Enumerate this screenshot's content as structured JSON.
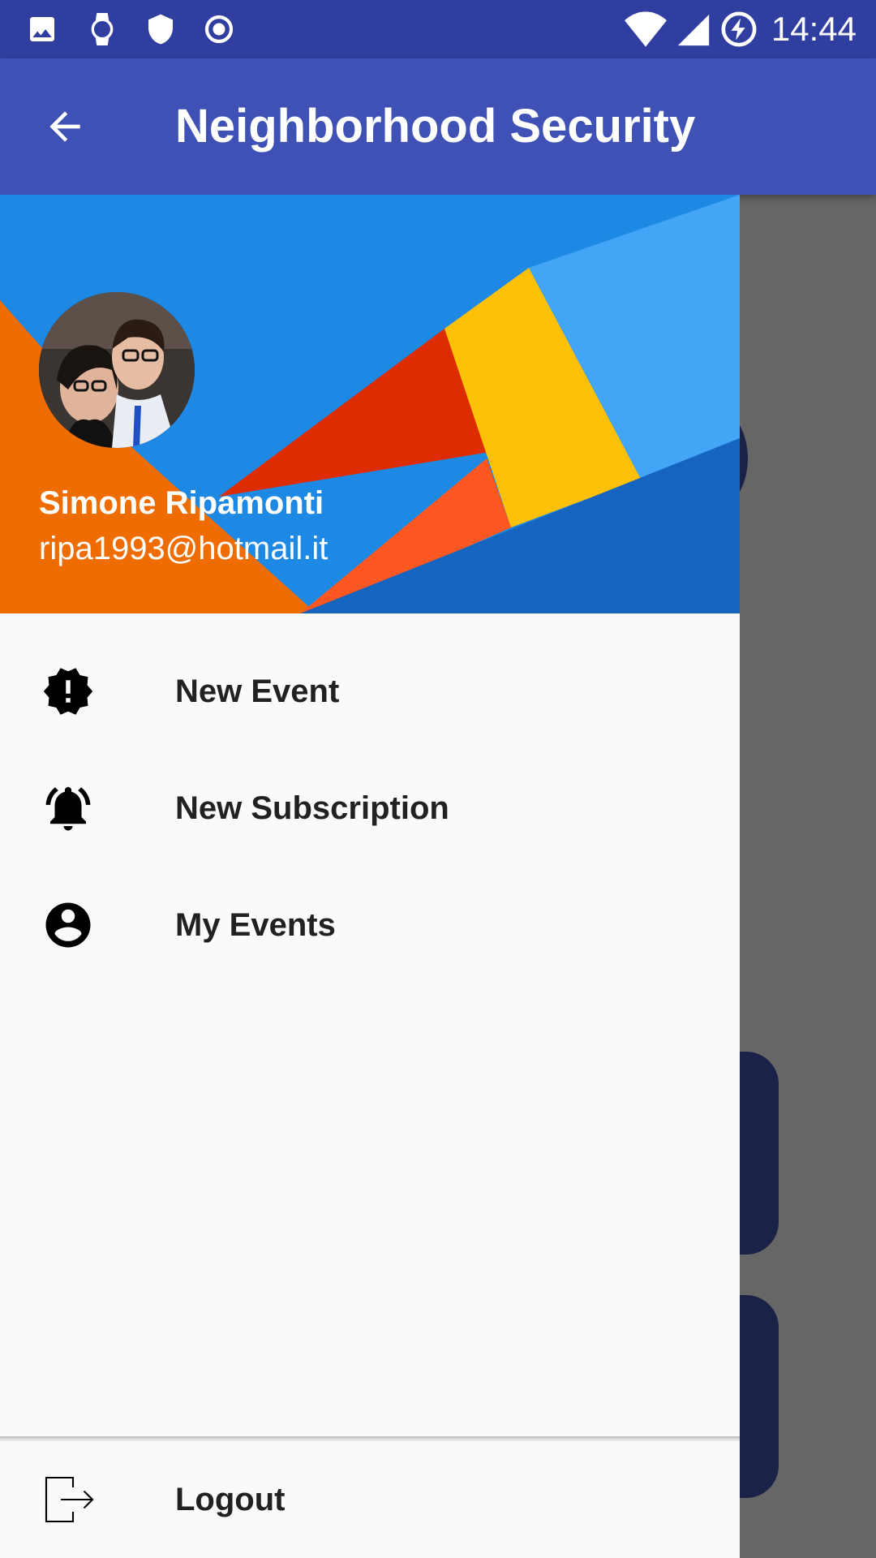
{
  "status_bar": {
    "time": "14:44",
    "icons": [
      "image-icon",
      "watch-icon",
      "shield-icon",
      "record-icon",
      "wifi-icon",
      "signal-icon",
      "battery-charging-icon"
    ]
  },
  "app_bar": {
    "title": "Neighborhood Security",
    "back_icon": "arrow-back-icon"
  },
  "drawer": {
    "header": {
      "name": "Simone Ripamonti",
      "email": "ripa1993@hotmail.it"
    },
    "items": [
      {
        "label": "New Event",
        "icon": "new-event-alert-icon"
      },
      {
        "label": "New Subscription",
        "icon": "notifications-active-icon"
      },
      {
        "label": "My Events",
        "icon": "account-circle-icon"
      }
    ],
    "footer": {
      "label": "Logout",
      "icon": "logout-icon"
    }
  },
  "colors": {
    "status_bar": "#303f9f",
    "primary": "#3f51b5",
    "scrim": "#666666",
    "drawer_bg": "#fafafa",
    "text_primary": "#212121"
  }
}
